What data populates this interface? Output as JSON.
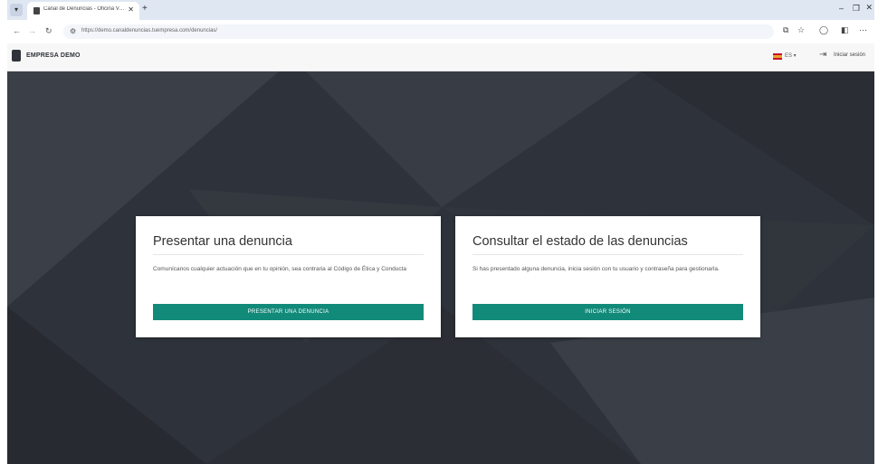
{
  "browser": {
    "tab_title": "Canal de Denuncias - Oficina V…",
    "url": "https://demo.canaldenuncias.tuempresa.com/denuncias/",
    "new_tab_glyph": "+",
    "close_tab_glyph": "✕",
    "window_controls": {
      "minimize": "–",
      "maximize": "❐",
      "close": "✕"
    },
    "icons": [
      "back-arrow-icon",
      "forward-arrow-icon",
      "reload-icon",
      "site-info-icon",
      "extension-icon",
      "star-icon",
      "profile-icon",
      "sidebar-icon",
      "menu-icon"
    ]
  },
  "header": {
    "brand": "EMPRESA DEMO",
    "language": "ES ▾",
    "login_label": "Iniciar sesión"
  },
  "cards": [
    {
      "title": "Presentar una denuncia",
      "text": "Comunícanos cualquier actuación que en tu opinión, sea contraria al Código de Ética y Conducta",
      "button": "PRESENTAR UNA DENUNCIA"
    },
    {
      "title": "Consultar el estado de las denuncias",
      "text": "Si has presentado alguna denuncia, inicia sesión con tu usuario y contraseña para gestionarla.",
      "button": "INICIAR SESIÓN"
    }
  ],
  "colors": {
    "accent": "#128a7a",
    "hero_background": "#2f333b",
    "tab_bar": "#dfe7f2"
  }
}
